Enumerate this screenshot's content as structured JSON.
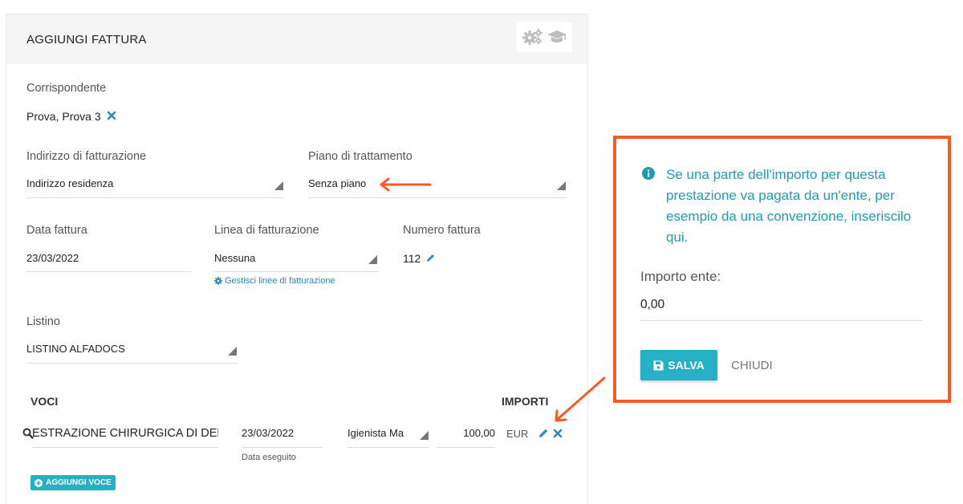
{
  "header": {
    "title": "AGGIUNGI FATTURA",
    "tool_icons": [
      "gears-icon",
      "graduation-cap-icon"
    ]
  },
  "corrispondente": {
    "label": "Corrispondente",
    "value": "Prova, Prova 3"
  },
  "indirizzo": {
    "label": "Indirizzo di fatturazione",
    "value": "Indirizzo residenza"
  },
  "piano": {
    "label": "Piano di trattamento",
    "value": "Senza piano"
  },
  "data_fattura": {
    "label": "Data fattura",
    "value": "23/03/2022"
  },
  "linea": {
    "label": "Linea di fatturazione",
    "value": "Nessuna",
    "manage_link": "Gestisci linee di fatturazione"
  },
  "numero": {
    "label": "Numero fattura",
    "value": "112"
  },
  "listino": {
    "label": "Listino",
    "value": "LISTINO ALFADOCS"
  },
  "voci": {
    "title": "VOCI",
    "importi_title": "IMPORTI",
    "rows": [
      {
        "description": "ESTRAZIONE CHIRURGICA DI DEN",
        "date": "23/03/2022",
        "date_label": "Data eseguito",
        "operator": "Igienista Ma",
        "amount": "100,00",
        "currency": "EUR"
      }
    ],
    "add_label": "AGGIUNGI VOCE"
  },
  "callout": {
    "info_text": "Se una parte dell'importo per questa prestazione va pagata da un'ente, per esempio da una convenzione, inseriscilo qui.",
    "ente_label": "Importo ente:",
    "ente_value": "0,00",
    "save_label": "SALVA",
    "close_label": "CHIUDI"
  },
  "colors": {
    "accent": "#26b0c6",
    "highlight": "#f45a2a",
    "info_text": "#1e9bb1",
    "link": "#2f86b8"
  }
}
